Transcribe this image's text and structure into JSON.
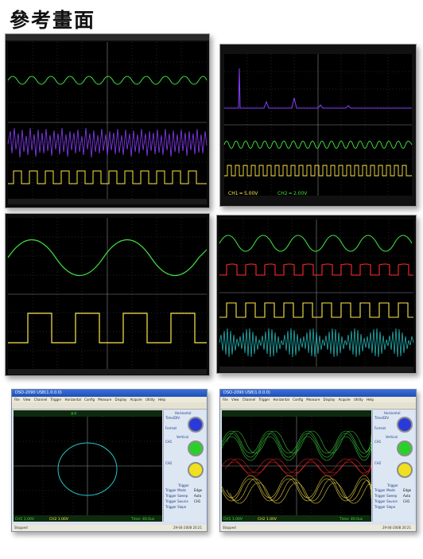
{
  "page": {
    "title": "參考畫面"
  },
  "screen_b": {
    "ch1_label": "CH1 ═ 5.00V",
    "ch2_label": "CH2 ═ 2.00V"
  },
  "window": {
    "title": "DSO-2090 USB(1.0.0.0)",
    "menu": "File View Channel Trigger Horizontal Config Measure Display Acquire Utility Help",
    "status_left": "Stopped",
    "status_time": "29-04-2008 20:21",
    "xy_status": "X-Y",
    "time_div": "Time: 40.0us",
    "ch1_status": "CH1  1.00V",
    "ch2_status": "CH2  1.00V",
    "panel": {
      "horizontal": "Horizontal",
      "time_div": "Time/DIV",
      "format": "Format",
      "vertical": "Vertical",
      "ch1": "CH1",
      "ch2": "CH2",
      "trigger": "Trigger",
      "trigger_mode": "Trigger Mode",
      "trigger_sweep": "Trigger Sweep",
      "trigger_source": "Trigger Source",
      "trigger_slope": "Trigger Slope",
      "mode_value": "Edge",
      "sweep_value": "Auto",
      "source_value": "CH1"
    }
  },
  "colors": {
    "green": "#3fe03f",
    "purple": "#8a3cff",
    "yellow": "#ffe84a",
    "red": "#ff2a2a",
    "teal": "#27c6c6",
    "grid": "#5a5a5a"
  }
}
